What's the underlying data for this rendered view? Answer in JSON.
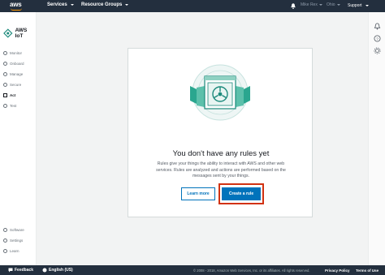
{
  "topnav": {
    "logo": "aws",
    "services_label": "Services",
    "resource_groups_label": "Resource Groups",
    "account_label": "Mike Rex",
    "region_label": "Ohio",
    "support_label": "Support",
    "bell_icon": "bell-icon"
  },
  "sidebar": {
    "brand": "AWS IoT",
    "items": [
      {
        "label": "Monitor",
        "icon": "monitor-icon"
      },
      {
        "label": "Onboard",
        "icon": "onboard-icon"
      },
      {
        "label": "Manage",
        "icon": "manage-icon"
      },
      {
        "label": "Secure",
        "icon": "lock-icon"
      },
      {
        "label": "Act",
        "icon": "act-icon"
      },
      {
        "label": "Test",
        "icon": "test-icon"
      }
    ],
    "bottom_items": [
      {
        "label": "Software",
        "icon": "software-icon"
      },
      {
        "label": "Settings",
        "icon": "gear-icon"
      },
      {
        "label": "Learn",
        "icon": "learn-icon"
      }
    ],
    "active_item": "Act"
  },
  "card": {
    "title": "You don't have any rules yet",
    "description": "Rules give your things the ability to interact with AWS and other web services. Rules are analyzed and actions are performed based on the messages sent by your things.",
    "learn_more_label": "Learn more",
    "create_rule_label": "Create a rule"
  },
  "footer": {
    "feedback_label": "Feedback",
    "language_label": "English (US)",
    "copyright": "© 2008 - 2018, Amazon Web Services, Inc. or its affiliates. All rights reserved.",
    "privacy_label": "Privacy Policy",
    "terms_label": "Terms of Use"
  },
  "colors": {
    "nav_bg": "#232f3e",
    "accent": "#0073bb",
    "teal": "#1d8a7c",
    "highlight": "#d13212"
  }
}
